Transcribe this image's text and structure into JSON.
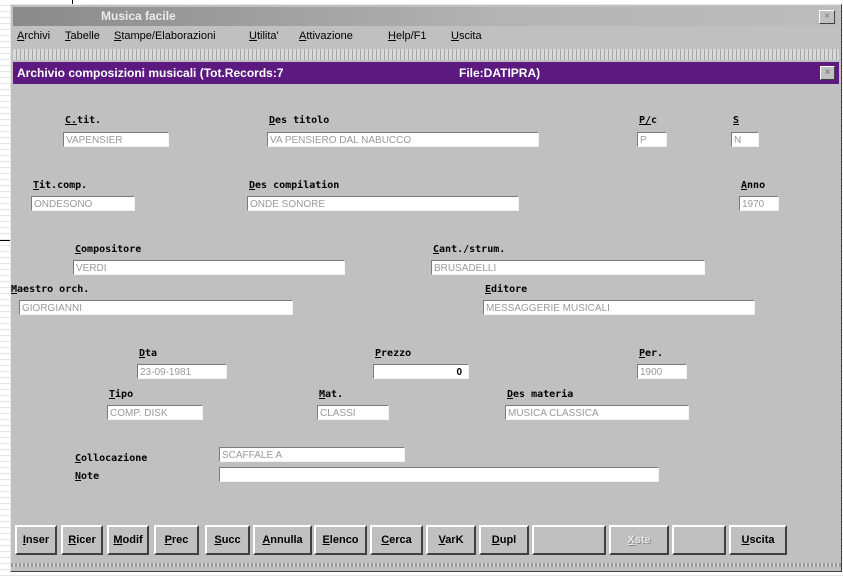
{
  "window": {
    "title": "Musica facile",
    "close": "×"
  },
  "menu": [
    {
      "label": "Archivi"
    },
    {
      "label": "Tabelle"
    },
    {
      "label": "Stampe/Elaborazioni"
    },
    {
      "label": "Utilita'"
    },
    {
      "label": "Attivazione"
    },
    {
      "label": "Help/F1"
    },
    {
      "label": "Uscita"
    }
  ],
  "form": {
    "title": "Archivio composizioni musicali (Tot.Records:7",
    "file": "File:DATIPRA)",
    "close": "×"
  },
  "fields": {
    "cod_tit": {
      "label": "C.tit.",
      "value": "VAPENSIER"
    },
    "des_titolo": {
      "label": "Des titolo",
      "value": "VA PENSIERO    DAL NABUCCO"
    },
    "pc": {
      "label": "P/c",
      "value": "P"
    },
    "s": {
      "label": "S",
      "value": "N"
    },
    "tit_comp": {
      "label": "Tit.comp.",
      "value": "ONDESONO"
    },
    "des_comp": {
      "label": "Des compilation",
      "value": "ONDE SONORE"
    },
    "anno": {
      "label": "Anno",
      "value": "1970"
    },
    "compositore": {
      "label": "Compositore",
      "value": "VERDI"
    },
    "cant": {
      "label": "Cant./strum.",
      "value": "BRUSADELLI"
    },
    "maestro": {
      "label": "Maestro orch.",
      "value": "GIORGIANNI"
    },
    "editore": {
      "label": "Editore",
      "value": "MESSAGGERIE MUSICALI"
    },
    "data": {
      "label": "Dta",
      "value": "23-09-1981"
    },
    "prezzo": {
      "label": "Prezzo",
      "value": "0"
    },
    "per": {
      "label": "Per.",
      "value": "1900"
    },
    "tipo": {
      "label": "Tipo",
      "value": "COMP. DISK"
    },
    "mat": {
      "label": "Mat.",
      "value": "CLASSI"
    },
    "des_materia": {
      "label": "Des materia",
      "value": "MUSICA CLASSICA"
    },
    "collocazione": {
      "label": "Collocazione",
      "value": "SCAFFALE A"
    },
    "note": {
      "label": "Note",
      "value": ""
    }
  },
  "buttons": [
    {
      "label": "Inser"
    },
    {
      "label": "Ricer"
    },
    {
      "label": "Modif"
    },
    {
      "label": "Prec"
    },
    {
      "label": "Succ"
    },
    {
      "label": "Annulla"
    },
    {
      "label": "Elenco"
    },
    {
      "label": "Cerca"
    },
    {
      "label": "VarK"
    },
    {
      "label": "Dupl"
    },
    {
      "label": ""
    },
    {
      "label": "Xste"
    },
    {
      "label": ""
    },
    {
      "label": "Uscita"
    }
  ]
}
